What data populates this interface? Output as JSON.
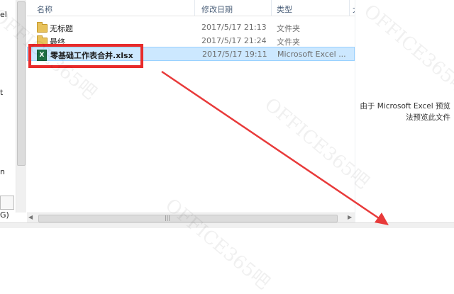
{
  "left_pane": {
    "texts": [
      "el",
      "t",
      "n",
      "G)"
    ]
  },
  "columns": {
    "name": "名称",
    "date": "修改日期",
    "type": "类型",
    "size": "大"
  },
  "files": [
    {
      "name": "无标题",
      "date": "2017/5/17 21:13",
      "type": "文件夹",
      "icon": "folder-icon",
      "selected": false
    },
    {
      "name": "最终",
      "date": "2017/5/17 21:24",
      "type": "文件夹",
      "icon": "folder-icon",
      "selected": false
    },
    {
      "name": "零基础工作表合并.xlsx",
      "date": "2017/5/17 19:11",
      "type": "Microsoft Excel ...",
      "icon": "excel-icon",
      "selected": true
    }
  ],
  "preview": {
    "line1": "由于 Microsoft Excel 预览",
    "line2": "法预览此文件"
  },
  "watermark": "OFFICE365吧",
  "colors": {
    "highlight": "#e82b2b",
    "selection": "#cce8ff",
    "arrow": "#e83a3a"
  }
}
